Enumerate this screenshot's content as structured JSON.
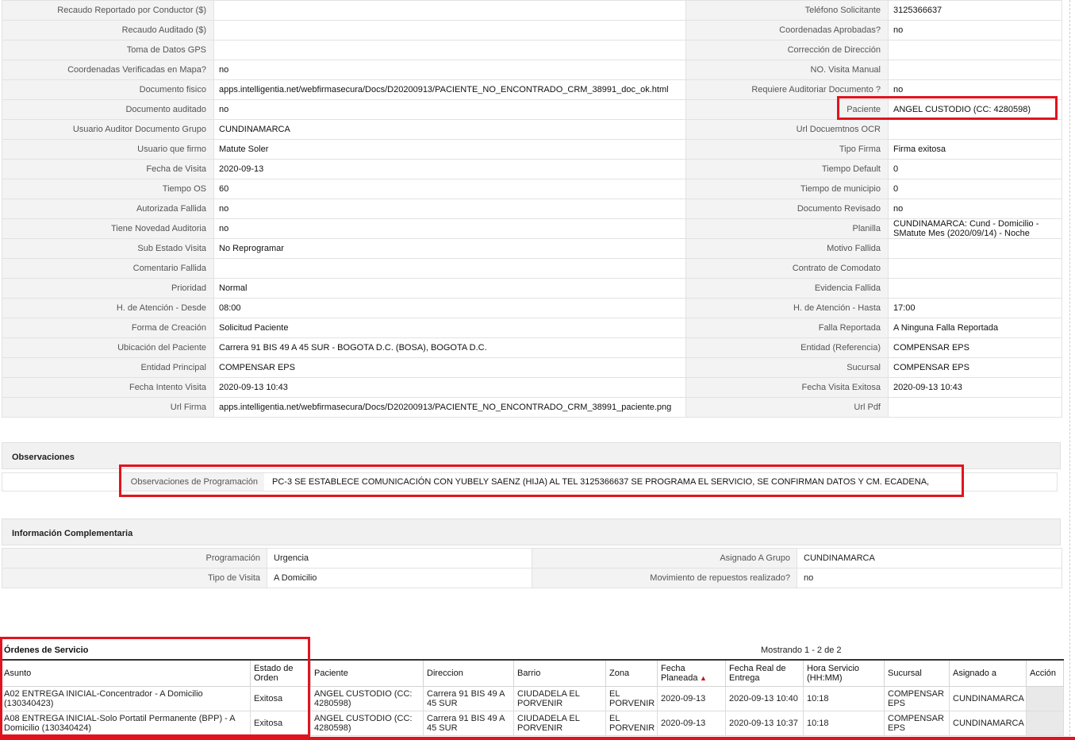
{
  "details": {
    "rows": [
      {
        "l1": "Recaudo Reportado por Conductor ($)",
        "v1": "",
        "l2": "Teléfono Solicitante",
        "v2": "3125366637"
      },
      {
        "l1": "Recaudo Auditado ($)",
        "v1": "",
        "l2": "Coordenadas Aprobadas?",
        "v2": "no"
      },
      {
        "l1": "Toma de Datos GPS",
        "v1": "",
        "l2": "Corrección de Dirección",
        "v2": ""
      },
      {
        "l1": "Coordenadas Verificadas en Mapa?",
        "v1": "no",
        "l2": "NO. Visita Manual",
        "v2": ""
      },
      {
        "l1": "Documento fisico",
        "v1": "apps.intelligentia.net/webfirmasecura/Docs/D20200913/PACIENTE_NO_ENCONTRADO_CRM_38991_doc_ok.html",
        "l2": "Requiere Auditoriar Documento ?",
        "v2": "no"
      },
      {
        "l1": "Documento auditado",
        "v1": "no",
        "l2": "Paciente",
        "v2": "ANGEL CUSTODIO (CC: 4280598)"
      },
      {
        "l1": "Usuario Auditor Documento Grupo",
        "v1": "CUNDINAMARCA",
        "l2": "Url Docuemtnos OCR",
        "v2": ""
      },
      {
        "l1": "Usuario que firmo",
        "v1": "Matute Soler",
        "l2": "Tipo Firma",
        "v2": "Firma exitosa"
      },
      {
        "l1": "Fecha de Visita",
        "v1": "2020-09-13",
        "l2": "Tiempo Default",
        "v2": "0"
      },
      {
        "l1": "Tiempo OS",
        "v1": "60",
        "l2": "Tiempo de municipio",
        "v2": "0"
      },
      {
        "l1": "Autorizada Fallida",
        "v1": "no",
        "l2": "Documento Revisado",
        "v2": "no"
      },
      {
        "l1": "Tiene Novedad Auditoria",
        "v1": "no",
        "l2": "Planilla",
        "v2": "CUNDINAMARCA: Cund - Domicilio - SMatute Mes (2020/09/14) - Noche"
      },
      {
        "l1": "Sub Estado Visita",
        "v1": "No Reprogramar",
        "l2": "Motivo Fallida",
        "v2": ""
      },
      {
        "l1": "Comentario Fallida",
        "v1": "",
        "l2": "Contrato de Comodato",
        "v2": ""
      },
      {
        "l1": "Prioridad",
        "v1": "Normal",
        "l2": "Evidencia Fallida",
        "v2": ""
      },
      {
        "l1": "H. de Atención - Desde",
        "v1": "08:00",
        "l2": "H. de Atención - Hasta",
        "v2": "17:00"
      },
      {
        "l1": "Forma de Creación",
        "v1": "Solicitud Paciente",
        "l2": "Falla Reportada",
        "v2": "A Ninguna Falla Reportada"
      },
      {
        "l1": "Ubicación del Paciente",
        "v1": "Carrera 91 BIS 49 A 45 SUR - BOGOTA D.C. (BOSA), BOGOTA D.C.",
        "l2": "Entidad (Referencia)",
        "v2": "COMPENSAR EPS"
      },
      {
        "l1": "Entidad Principal",
        "v1": "COMPENSAR EPS",
        "l2": "Sucursal",
        "v2": "COMPENSAR EPS"
      },
      {
        "l1": "Fecha Intento Visita",
        "v1": "2020-09-13 10:43",
        "l2": "Fecha Visita Exitosa",
        "v2": "2020-09-13 10:43"
      },
      {
        "l1": "Url Firma",
        "v1": "apps.intelligentia.net/webfirmasecura/Docs/D20200913/PACIENTE_NO_ENCONTRADO_CRM_38991_paciente.png",
        "l2": "Url Pdf",
        "v2": ""
      }
    ]
  },
  "observaciones": {
    "title": "Observaciones",
    "label": "Observaciones de Programación",
    "value": "PC-3 SE ESTABLECE COMUNICACIÓN CON YUBELY SAENZ (HIJA) AL TEL 3125366637 SE PROGRAMA EL SERVICIO, SE CONFIRMAN DATOS Y CM. ECADENA,"
  },
  "info": {
    "title": "Información Complementaria",
    "rows": [
      {
        "l1": "Programación",
        "v1": "Urgencia",
        "l2": "Asignado A Grupo",
        "v2": "CUNDINAMARCA"
      },
      {
        "l1": "Tipo de Visita",
        "v1": "A Domicilio",
        "l2": "Movimiento de repuestos realizado?",
        "v2": "no"
      }
    ]
  },
  "orders": {
    "title": "Órdenes de Servicio",
    "count": "Mostrando 1 - 2 de 2",
    "headers": [
      "Asunto",
      "Estado de Orden",
      "Paciente",
      "Direccion",
      "Barrio",
      "Zona",
      "Fecha Planeada",
      "Fecha Real de Entrega",
      "Hora Servicio (HH:MM)",
      "Sucursal",
      "Asignado a",
      "Acción"
    ],
    "rows": [
      [
        "A02 ENTREGA INICIAL-Concentrador - A Domicilio (130340423)",
        "Exitosa",
        "ANGEL CUSTODIO (CC: 4280598)",
        "Carrera 91 BIS 49 A 45 SUR",
        "CIUDADELA EL PORVENIR",
        "EL PORVENIR",
        "2020-09-13",
        "2020-09-13 10:40",
        "10:18",
        "COMPENSAR EPS",
        "CUNDINAMARCA",
        ""
      ],
      [
        "A08 ENTREGA INICIAL-Solo Portatil Permanente (BPP) - A Domicilio (130340424)",
        "Exitosa",
        "ANGEL CUSTODIO (CC: 4280598)",
        "Carrera 91 BIS 49 A 45 SUR",
        "CIUDADELA EL PORVENIR",
        "EL PORVENIR",
        "2020-09-13",
        "2020-09-13 10:37",
        "10:18",
        "COMPENSAR EPS",
        "CUNDINAMARCA",
        ""
      ]
    ]
  },
  "colors": {
    "highlight": "#e1141e",
    "label_bg": "#f3f3f3",
    "section_bg": "#f1f1f1"
  }
}
